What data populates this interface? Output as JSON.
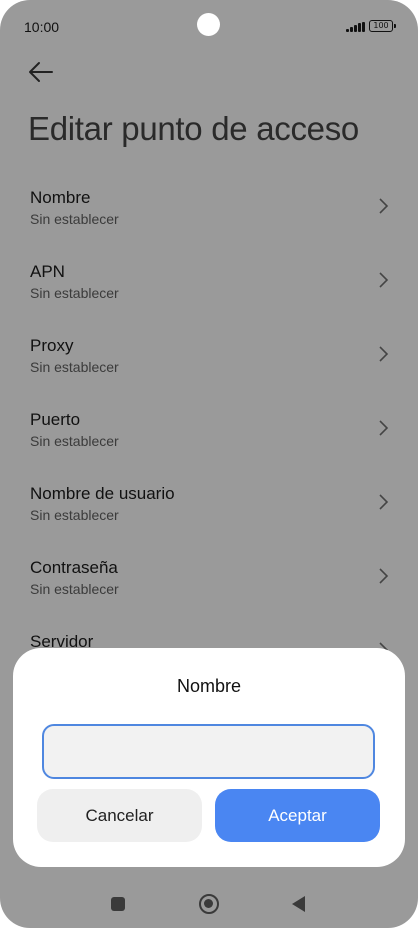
{
  "status_bar": {
    "time": "10:00",
    "battery": "100"
  },
  "page": {
    "title": "Editar punto de acceso"
  },
  "settings": {
    "items": [
      {
        "title": "Nombre",
        "subtitle": "Sin establecer"
      },
      {
        "title": "APN",
        "subtitle": "Sin establecer"
      },
      {
        "title": "Proxy",
        "subtitle": "Sin establecer"
      },
      {
        "title": "Puerto",
        "subtitle": "Sin establecer"
      },
      {
        "title": "Nombre de usuario",
        "subtitle": "Sin establecer"
      },
      {
        "title": "Contraseña",
        "subtitle": "Sin establecer"
      },
      {
        "title": "Servidor",
        "subtitle": ""
      }
    ]
  },
  "dialog": {
    "title": "Nombre",
    "input_value": "",
    "cancel_label": "Cancelar",
    "accept_label": "Aceptar"
  },
  "colors": {
    "accent": "#4a86f2",
    "overlay_background": "#9a9a9a",
    "input_border": "#4f87e0"
  },
  "icons": {
    "back": "arrow-left-icon",
    "chevron": "chevron-right-icon",
    "nav_recents": "square-icon",
    "nav_home": "circle-icon",
    "nav_back": "triangle-left-icon"
  }
}
